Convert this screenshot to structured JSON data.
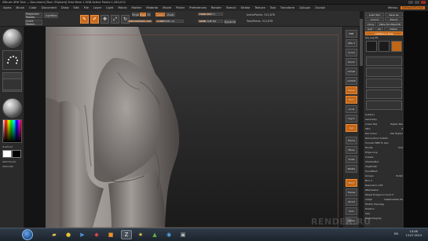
{
  "titlebar": {
    "title": "ZBrush 4R6 Trial — Document  [Tool: ZSphere]  Free Mem 1.5GB  Active Points 1,284,012",
    "menu_right": "Menus  DefaultZScript"
  },
  "menubar": {
    "items": [
      "Alpha",
      "Brush",
      "Color",
      "Document",
      "Draw",
      "Edit",
      "File",
      "Layer",
      "Light",
      "Macro",
      "Marker",
      "Material",
      "Movie",
      "Picker",
      "Preferences",
      "Render",
      "Stencil",
      "Stroke",
      "Texture",
      "Tool",
      "Transform",
      "Zplugin",
      "Zscript"
    ],
    "right_items": [
      "Menus",
      "DefaultZScript"
    ]
  },
  "shelf": {
    "projection_master": "Projection Master",
    "lightbox": "LightBox",
    "quick_sketch": "Quick Sketch",
    "edit": "Edit",
    "draw": "Draw",
    "move": "Move",
    "scale": "Scale",
    "rotate": "Rotate",
    "mrgb": "Mrgb",
    "rgb": "Rgb",
    "m": "M",
    "rgb_intensity": "Rgb Intensity 100",
    "zadd": "Zadd",
    "zsub": "Zsub",
    "z_intensity": "Z Intensity 25",
    "focal_shift": "Focal Shift 0",
    "draw_size": "Draw Size 64",
    "dynamic": "Dynamic",
    "active_points": "ActivePoints: 312,878",
    "total_points": "TotalPoints: 312,878"
  },
  "left_tray": {
    "gradient_label": "Gradient",
    "switch_color_label": "SwitchColor",
    "alternate_label": "Alternate"
  },
  "right_shelf": {
    "buttons": [
      "BPR",
      "SPix 3",
      "Scroll",
      "Zoom",
      "Actual",
      "AAHalf",
      "Persp",
      "Floor",
      "Local",
      "LSym",
      "Xyz",
      "Frame",
      "Move",
      "Scale",
      "Rotate",
      "PolyF",
      "Transp",
      "Ghost",
      "Solo",
      "Xpose"
    ]
  },
  "tray": {
    "title": "Tool",
    "load_tool": "Load Tool",
    "save_as": "Save As",
    "import": "Import",
    "export": "Export",
    "clone": "Clone",
    "make_polymesh": "Make PolyMesh3D",
    "goz": "GoZ",
    "all": "All",
    "visible": "Visible",
    "lightbox_tools": "Lightbox ▸ Tools",
    "subtool_name": "Ipa_Leg 48",
    "rows": [
      {
        "label": "SubTool",
        "value": ""
      },
      {
        "label": "Geometry",
        "value": ""
      },
      {
        "label": "Lower Res",
        "value": "Higher Res"
      },
      {
        "label": "SDiv",
        "value": "3"
      },
      {
        "label": "Del Lower",
        "value": "Del Higher"
      },
      {
        "label": "Reconstruct Subdiv",
        "value": ""
      },
      {
        "label": "Convert BPR To Geo",
        "value": ""
      },
      {
        "label": "Divide",
        "value": "Smt"
      },
      {
        "label": "Edge Loop",
        "value": ""
      },
      {
        "label": "Crease",
        "value": ""
      },
      {
        "label": "ShadowBox",
        "value": ""
      },
      {
        "label": "ClayPolish",
        "value": ""
      },
      {
        "label": "DynaMesh",
        "value": ""
      },
      {
        "label": "Groups",
        "value": "Polish"
      },
      {
        "label": "Blur 2",
        "value": ""
      },
      {
        "label": "Resolution 128",
        "value": ""
      },
      {
        "label": "ZRemesher",
        "value": ""
      },
      {
        "label": "Target Polygons Count 5",
        "value": ""
      },
      {
        "label": "Adapt",
        "value": "AdaptiveSize 50"
      },
      {
        "label": "Modify Topology",
        "value": ""
      },
      {
        "label": "Position",
        "value": ""
      },
      {
        "label": "Size",
        "value": ""
      },
      {
        "label": "MeshIntegrity",
        "value": ""
      }
    ]
  },
  "taskbar": {
    "lang": "EN",
    "time": "14:46",
    "date": "13.07.2013"
  },
  "watermark": "RENDER.RU",
  "colors": {
    "accent": "#c86a1b",
    "background": "#2d2d2d",
    "viewport_top": "#3e3e3e"
  }
}
